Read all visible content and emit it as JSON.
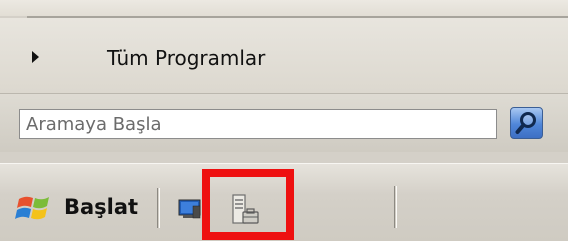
{
  "start_menu": {
    "all_programs_label": "Tüm Programlar",
    "search": {
      "placeholder": "Aramaya Başla",
      "value": ""
    }
  },
  "taskbar": {
    "start_label": "Başlat",
    "quick_launch": [
      "show-desktop-icon",
      "server-manager-icon"
    ],
    "highlight_color": "#ee1010"
  },
  "icons": {
    "arrow": "arrow-right-icon",
    "search": "magnifier-icon",
    "start_logo": "windows-logo-icon"
  }
}
